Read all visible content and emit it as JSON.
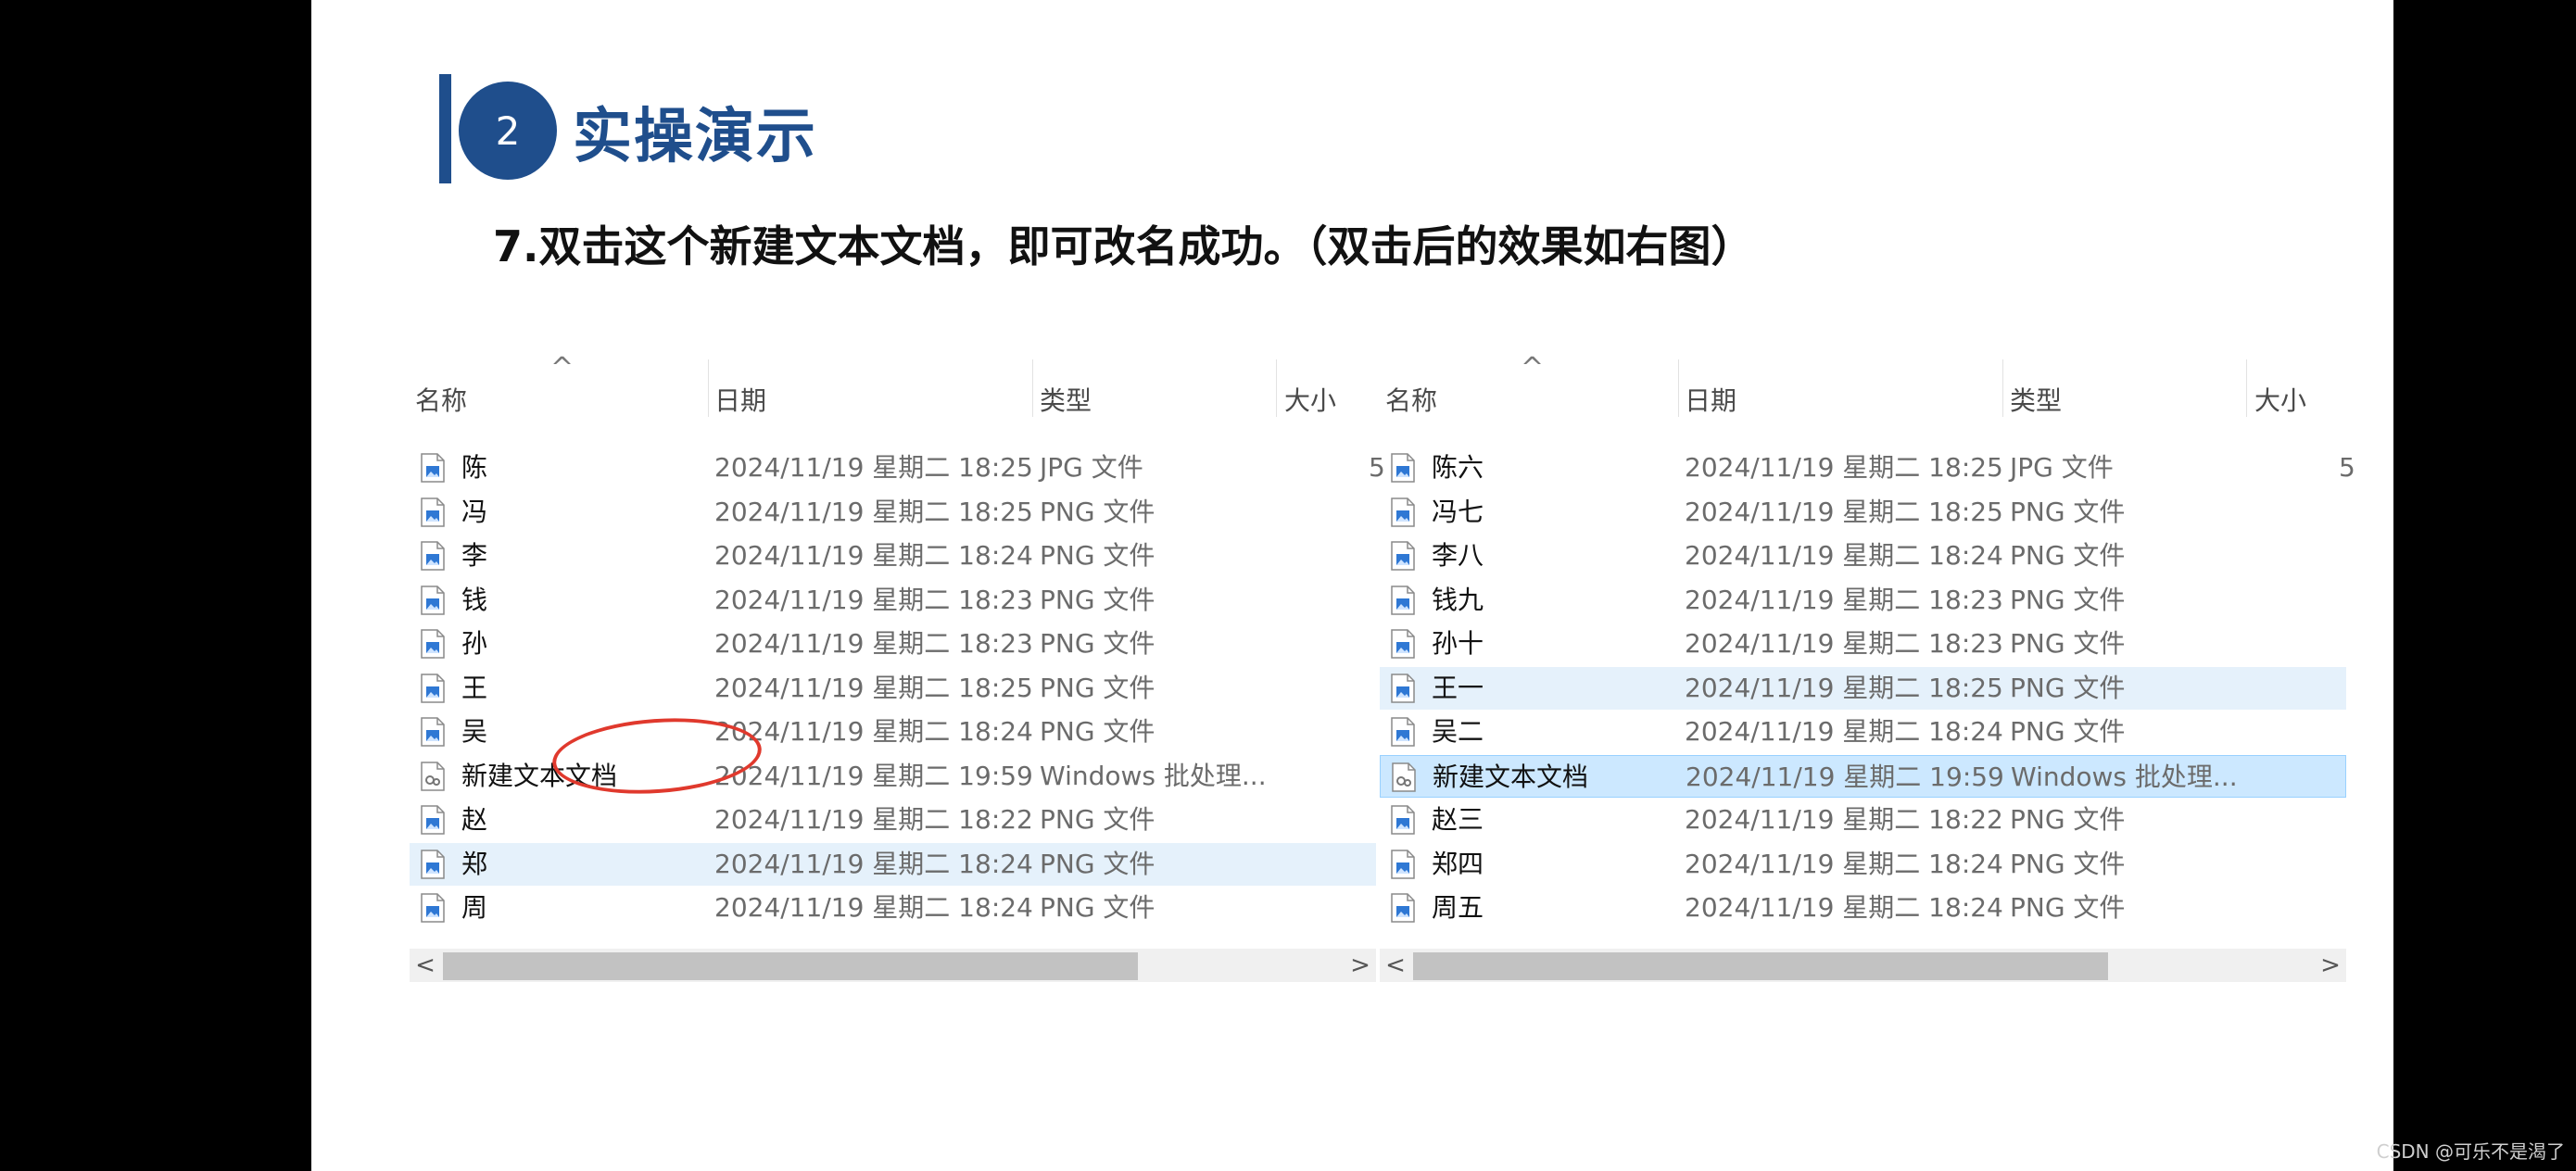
{
  "slide": {
    "number": "2",
    "title": "实操演示",
    "instruction": "7.双击这个新建文本文档，即可改名成功。（双击后的效果如右图）"
  },
  "columns": {
    "name": "名称",
    "date": "日期",
    "type": "类型",
    "size": "大小"
  },
  "left_explorer": {
    "rows": [
      {
        "name": "陈",
        "date": "2024/11/19 星期二 18:25",
        "type": "JPG 文件",
        "size": "5",
        "icon": "image-file-icon",
        "state": "normal"
      },
      {
        "name": "冯",
        "date": "2024/11/19 星期二 18:25",
        "type": "PNG 文件",
        "size": "",
        "icon": "image-file-icon",
        "state": "normal"
      },
      {
        "name": "李",
        "date": "2024/11/19 星期二 18:24",
        "type": "PNG 文件",
        "size": "",
        "icon": "image-file-icon",
        "state": "normal"
      },
      {
        "name": "钱",
        "date": "2024/11/19 星期二 18:23",
        "type": "PNG 文件",
        "size": "",
        "icon": "image-file-icon",
        "state": "normal"
      },
      {
        "name": "孙",
        "date": "2024/11/19 星期二 18:23",
        "type": "PNG 文件",
        "size": "",
        "icon": "image-file-icon",
        "state": "normal"
      },
      {
        "name": "王",
        "date": "2024/11/19 星期二 18:25",
        "type": "PNG 文件",
        "size": "",
        "icon": "image-file-icon",
        "state": "normal"
      },
      {
        "name": "吴",
        "date": "2024/11/19 星期二 18:24",
        "type": "PNG 文件",
        "size": "",
        "icon": "image-file-icon",
        "state": "normal"
      },
      {
        "name": "新建文本文档",
        "date": "2024/11/19 星期二 19:59",
        "type": "Windows 批处理...",
        "size": "",
        "icon": "batch-file-icon",
        "state": "normal"
      },
      {
        "name": "赵",
        "date": "2024/11/19 星期二 18:22",
        "type": "PNG 文件",
        "size": "",
        "icon": "image-file-icon",
        "state": "normal"
      },
      {
        "name": "郑",
        "date": "2024/11/19 星期二 18:24",
        "type": "PNG 文件",
        "size": "",
        "icon": "image-file-icon",
        "state": "hover"
      },
      {
        "name": "周",
        "date": "2024/11/19 星期二 18:24",
        "type": "PNG 文件",
        "size": "",
        "icon": "image-file-icon",
        "state": "normal"
      }
    ]
  },
  "right_explorer": {
    "rows": [
      {
        "name": "陈六",
        "date": "2024/11/19 星期二 18:25",
        "type": "JPG 文件",
        "size": "5",
        "icon": "image-file-icon",
        "state": "normal"
      },
      {
        "name": "冯七",
        "date": "2024/11/19 星期二 18:25",
        "type": "PNG 文件",
        "size": "",
        "icon": "image-file-icon",
        "state": "normal"
      },
      {
        "name": "李八",
        "date": "2024/11/19 星期二 18:24",
        "type": "PNG 文件",
        "size": "",
        "icon": "image-file-icon",
        "state": "normal"
      },
      {
        "name": "钱九",
        "date": "2024/11/19 星期二 18:23",
        "type": "PNG 文件",
        "size": "",
        "icon": "image-file-icon",
        "state": "normal"
      },
      {
        "name": "孙十",
        "date": "2024/11/19 星期二 18:23",
        "type": "PNG 文件",
        "size": "",
        "icon": "image-file-icon",
        "state": "normal"
      },
      {
        "name": "王一",
        "date": "2024/11/19 星期二 18:25",
        "type": "PNG 文件",
        "size": "",
        "icon": "image-file-icon",
        "state": "hover"
      },
      {
        "name": "吴二",
        "date": "2024/11/19 星期二 18:24",
        "type": "PNG 文件",
        "size": "",
        "icon": "image-file-icon",
        "state": "normal"
      },
      {
        "name": "新建文本文档",
        "date": "2024/11/19 星期二 19:59",
        "type": "Windows 批处理...",
        "size": "",
        "icon": "batch-file-icon",
        "state": "selected"
      },
      {
        "name": "赵三",
        "date": "2024/11/19 星期二 18:22",
        "type": "PNG 文件",
        "size": "",
        "icon": "image-file-icon",
        "state": "normal"
      },
      {
        "name": "郑四",
        "date": "2024/11/19 星期二 18:24",
        "type": "PNG 文件",
        "size": "",
        "icon": "image-file-icon",
        "state": "normal"
      },
      {
        "name": "周五",
        "date": "2024/11/19 星期二 18:24",
        "type": "PNG 文件",
        "size": "",
        "icon": "image-file-icon",
        "state": "normal"
      }
    ]
  },
  "scrollbar": {
    "left_arrow": "<",
    "right_arrow": ">"
  },
  "sort_caret": "^",
  "watermark": "CSDN @可乐不是渴了",
  "colors": {
    "accent": "#1f4e8c",
    "annotation": "#e0392d",
    "hover": "#e5f1fb",
    "selected": "#cce8ff"
  }
}
